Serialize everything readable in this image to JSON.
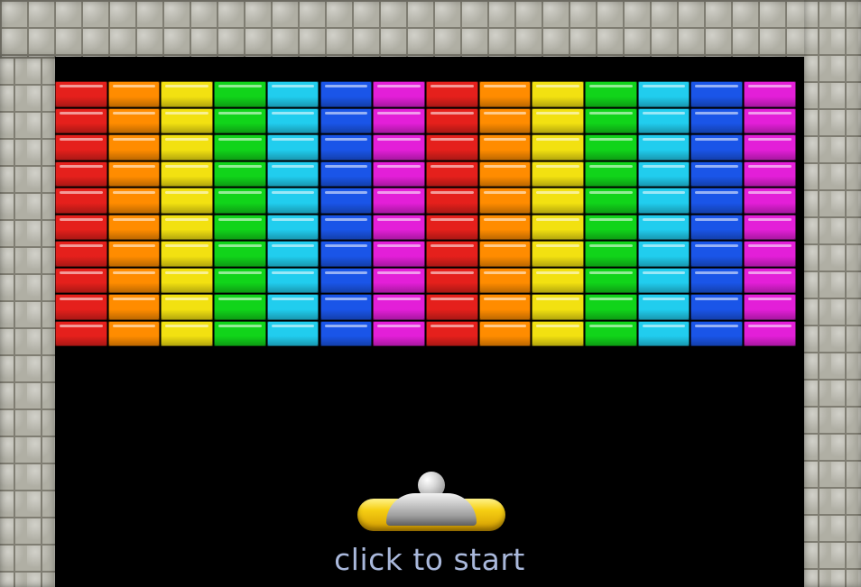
{
  "game": {
    "start_prompt": "click to start",
    "brick_rows": 10,
    "brick_columns": [
      {
        "color": "#e5201c",
        "name": "red"
      },
      {
        "color": "#ff8c00",
        "name": "orange"
      },
      {
        "color": "#f2e111",
        "name": "yellow"
      },
      {
        "color": "#11d41a",
        "name": "green"
      },
      {
        "color": "#21cdee",
        "name": "cyan"
      },
      {
        "color": "#1a55e8",
        "name": "blue"
      },
      {
        "color": "#e31fd8",
        "name": "magenta"
      },
      {
        "color": "#e5201c",
        "name": "red"
      },
      {
        "color": "#ff8c00",
        "name": "orange"
      },
      {
        "color": "#f2e111",
        "name": "yellow"
      },
      {
        "color": "#11d41a",
        "name": "green"
      },
      {
        "color": "#21cdee",
        "name": "cyan"
      },
      {
        "color": "#1a55e8",
        "name": "blue"
      },
      {
        "color": "#e31fd8",
        "name": "magenta"
      }
    ],
    "paddle": {
      "color": "#f6cf13",
      "icon": "paddle-icon"
    },
    "ball": {
      "color": "#d8d8d8",
      "icon": "ball-icon"
    },
    "wall_texture": "stone-brick"
  }
}
